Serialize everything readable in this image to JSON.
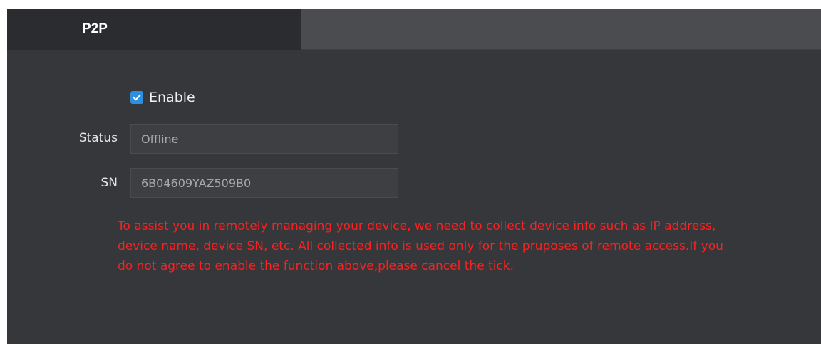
{
  "tabs": [
    {
      "label": "P2P",
      "active": true
    }
  ],
  "enable": {
    "label": "Enable",
    "checked": true,
    "checkbox_color": "#2e8fe0"
  },
  "fields": {
    "status": {
      "label": "Status",
      "value": "Offline"
    },
    "sn": {
      "label": "SN",
      "value": "6B04609YAZ509B0"
    }
  },
  "notice": {
    "text": "To assist you in remotely managing your device, we need to collect device info such as IP address, device name, device SN, etc. All collected info is used only for the pruposes of remote access.If you do not agree to enable the function above,please cancel the tick.",
    "color": "#ff1f1f"
  },
  "colors": {
    "panel_background": "#36373a",
    "tab_active_background": "#2b2c2f",
    "tab_bar_background": "#4b4c50"
  }
}
